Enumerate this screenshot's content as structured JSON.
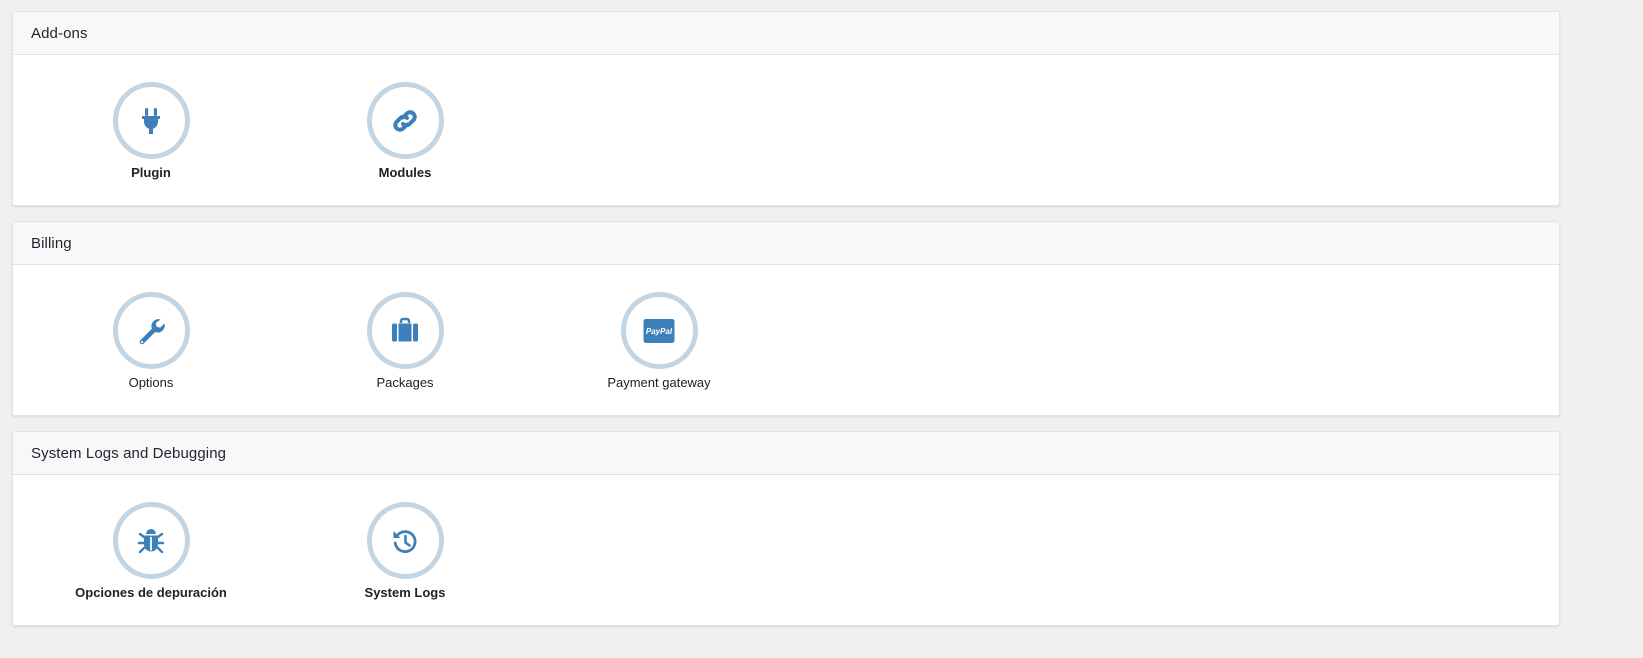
{
  "sections": [
    {
      "title": "Add-ons",
      "items": [
        {
          "label": "Plugin",
          "icon": "plug-icon"
        },
        {
          "label": "Modules",
          "icon": "link-icon"
        }
      ]
    },
    {
      "title": "Billing",
      "items": [
        {
          "label": "Options",
          "icon": "wrench-icon"
        },
        {
          "label": "Packages",
          "icon": "suitcase-icon"
        },
        {
          "label": "Payment gateway",
          "icon": "paypal-icon",
          "icon_text": "PayPal"
        }
      ]
    },
    {
      "title": "System Logs and Debugging",
      "items": [
        {
          "label": "Opciones de depuración",
          "icon": "bug-icon"
        },
        {
          "label": "System Logs",
          "icon": "history-icon"
        }
      ]
    }
  ],
  "colors": {
    "icon": "#3d7fb8",
    "ring": "#c3d5e2",
    "header_bg": "#f7f8f9"
  }
}
